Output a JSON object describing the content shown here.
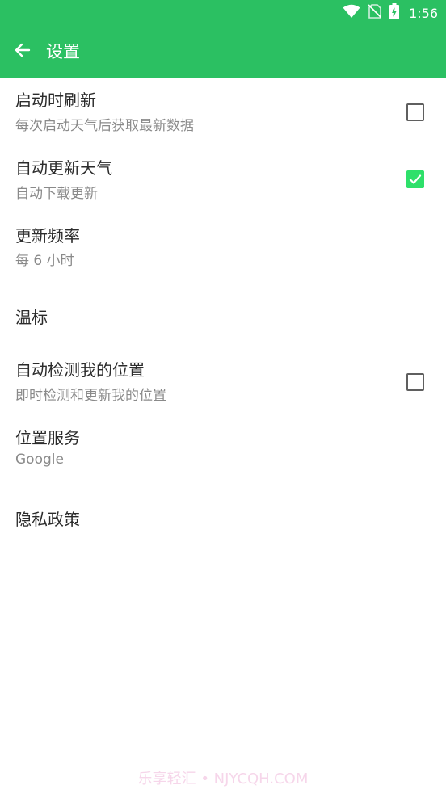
{
  "status_bar": {
    "time": "1:56",
    "icons": [
      "wifi-icon",
      "no-sim-icon",
      "battery-charging-icon"
    ]
  },
  "toolbar": {
    "title": "设置",
    "back_icon": "arrow-left-icon"
  },
  "settings": [
    {
      "title": "启动时刷新",
      "summary": "每次启动天气后获取最新数据",
      "checkbox": false
    },
    {
      "title": "自动更新天气",
      "summary": "自动下载更新",
      "checkbox": true
    },
    {
      "title": "更新频率",
      "summary": "每 6 小时"
    },
    {
      "title": "温标"
    },
    {
      "title": "自动检测我的位置",
      "summary": "即时检测和更新我的位置",
      "checkbox": false
    },
    {
      "title": "位置服务",
      "summary": "Google"
    },
    {
      "title": "隐私政策"
    }
  ],
  "watermark": "乐享轻汇 • NJYCQH.COM",
  "colors": {
    "accent": "#2bc062",
    "checkbox_checked": "#2ee06a",
    "title_text": "#2b2b2b",
    "summary_text": "#8a8a8a"
  }
}
